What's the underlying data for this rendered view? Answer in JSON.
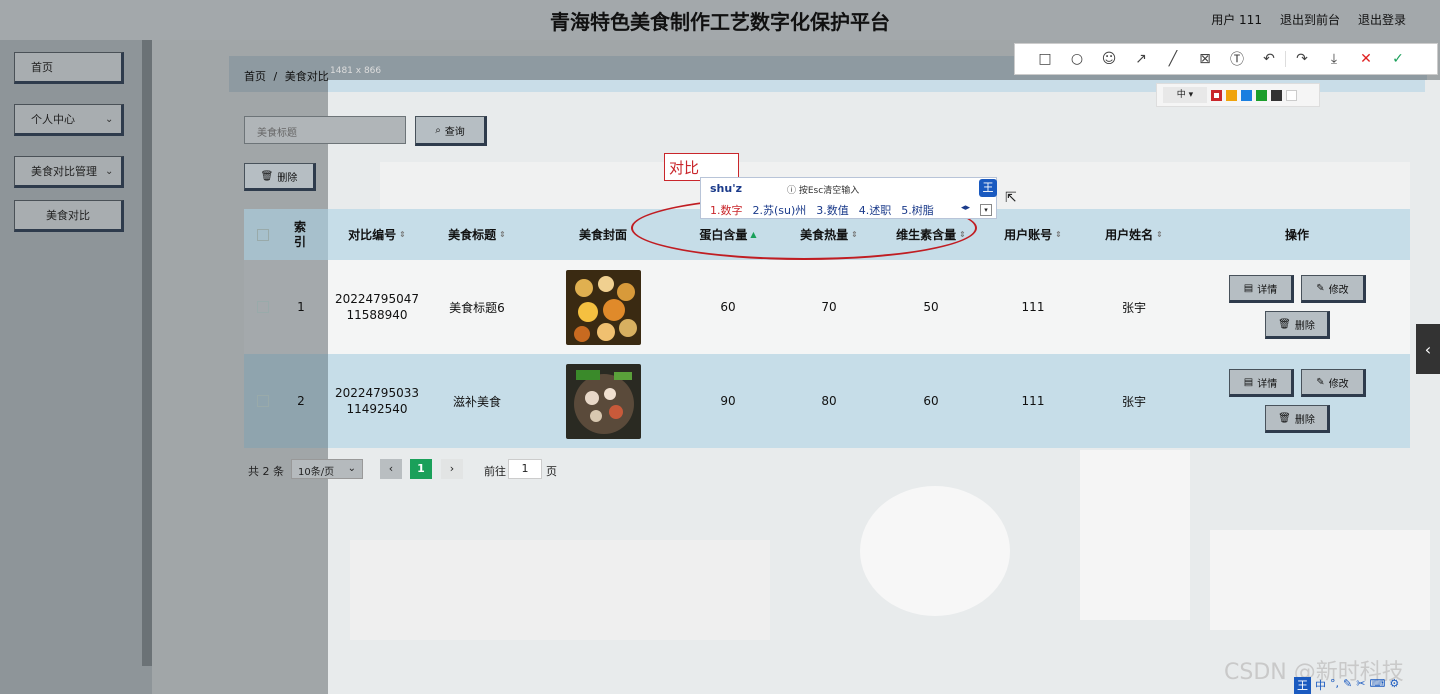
{
  "header": {
    "title": "青海特色美食制作工艺数字化保护平台",
    "user": "用户 111",
    "back_front": "退出到前台",
    "logout": "退出登录"
  },
  "sidebar": {
    "items": [
      {
        "label": "首页"
      },
      {
        "label": "个人中心"
      },
      {
        "label": "美食对比管理"
      },
      {
        "label": "美食对比"
      }
    ]
  },
  "breadcrumb": {
    "home": "首页",
    "sep": "/",
    "current": "美食对比"
  },
  "screenshot_dim": "1481 x 866",
  "search": {
    "placeholder": "美食标题",
    "query_label": "查询"
  },
  "delete_label": "删除",
  "table": {
    "columns": [
      "索引",
      "对比编号",
      "美食标题",
      "美食封面",
      "蛋白含量",
      "美食热量",
      "维生素含量",
      "用户账号",
      "用户姓名",
      "操作"
    ],
    "rows": [
      {
        "index": "1",
        "code": "2022479504711588940",
        "title": "美食标题6",
        "protein": "60",
        "calories": "70",
        "vitamin": "50",
        "account": "111",
        "name": "张宇"
      },
      {
        "index": "2",
        "code": "2022479503311492540",
        "title": "滋补美食",
        "protein": "90",
        "calories": "80",
        "vitamin": "60",
        "account": "111",
        "name": "张宇"
      }
    ],
    "actions": {
      "detail": "详情",
      "edit": "修改",
      "delete": "删除"
    }
  },
  "pager": {
    "total": "共 2 条",
    "page_size": "10条/页",
    "current": "1",
    "goto_prefix": "前往",
    "goto_value": "1",
    "goto_suffix": "页"
  },
  "annotation": {
    "text": "对比"
  },
  "ime": {
    "input": "shu'z",
    "hint": "按Esc清空输入",
    "candidates": [
      "1.数字",
      "2.苏(su)州",
      "3.数值",
      "4.述职",
      "5.树脂"
    ]
  },
  "annot_toolbar": {
    "size": "中"
  },
  "colors": {
    "red": "#c9262b",
    "orange": "#f0a30a",
    "blue": "#1a7fe0",
    "green": "#1b9e2b",
    "dark": "#333333",
    "white": "#ffffff",
    "accent_green": "#1aa05a"
  },
  "watermark": "CSDN @新时科技"
}
